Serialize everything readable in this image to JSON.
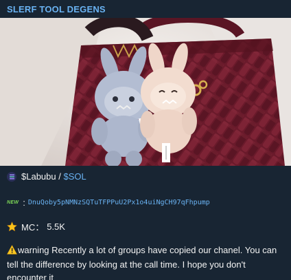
{
  "channel": {
    "name": "SLERF TOOL DEGENS"
  },
  "post": {
    "ticker": "$Labubu",
    "separator": " / ",
    "chain": "$SOL",
    "new_badge": "NEW",
    "ca_prefix": ":",
    "contract_address": "DnuQoby5pNMNzSQTuTFPPuU2Px1o4uiNgCH97qFhpump",
    "mc_label": "MC：",
    "mc_value": "5.5K",
    "warning_text": "warning Recently a lot of groups have copied our chanel. You can tell the difference by looking at the call time. I hope you don't encounter it"
  },
  "icons": {
    "chain_icon": "solana-icon",
    "star": "star-icon",
    "warning": "warning-icon",
    "new": "new-badge-icon"
  },
  "colors": {
    "background": "#182533",
    "accent": "#6ab3f3",
    "text": "#f2f2f2",
    "bag": "#6b1a2c"
  }
}
